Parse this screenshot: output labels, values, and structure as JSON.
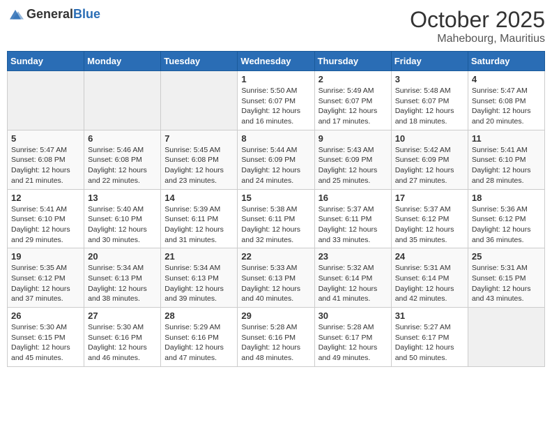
{
  "header": {
    "logo": {
      "general": "General",
      "blue": "Blue"
    },
    "month": "October 2025",
    "location": "Mahebourg, Mauritius"
  },
  "weekdays": [
    "Sunday",
    "Monday",
    "Tuesday",
    "Wednesday",
    "Thursday",
    "Friday",
    "Saturday"
  ],
  "weeks": [
    [
      {
        "day": "",
        "info": ""
      },
      {
        "day": "",
        "info": ""
      },
      {
        "day": "",
        "info": ""
      },
      {
        "day": "1",
        "info": "Sunrise: 5:50 AM\nSunset: 6:07 PM\nDaylight: 12 hours\nand 16 minutes."
      },
      {
        "day": "2",
        "info": "Sunrise: 5:49 AM\nSunset: 6:07 PM\nDaylight: 12 hours\nand 17 minutes."
      },
      {
        "day": "3",
        "info": "Sunrise: 5:48 AM\nSunset: 6:07 PM\nDaylight: 12 hours\nand 18 minutes."
      },
      {
        "day": "4",
        "info": "Sunrise: 5:47 AM\nSunset: 6:08 PM\nDaylight: 12 hours\nand 20 minutes."
      }
    ],
    [
      {
        "day": "5",
        "info": "Sunrise: 5:47 AM\nSunset: 6:08 PM\nDaylight: 12 hours\nand 21 minutes."
      },
      {
        "day": "6",
        "info": "Sunrise: 5:46 AM\nSunset: 6:08 PM\nDaylight: 12 hours\nand 22 minutes."
      },
      {
        "day": "7",
        "info": "Sunrise: 5:45 AM\nSunset: 6:08 PM\nDaylight: 12 hours\nand 23 minutes."
      },
      {
        "day": "8",
        "info": "Sunrise: 5:44 AM\nSunset: 6:09 PM\nDaylight: 12 hours\nand 24 minutes."
      },
      {
        "day": "9",
        "info": "Sunrise: 5:43 AM\nSunset: 6:09 PM\nDaylight: 12 hours\nand 25 minutes."
      },
      {
        "day": "10",
        "info": "Sunrise: 5:42 AM\nSunset: 6:09 PM\nDaylight: 12 hours\nand 27 minutes."
      },
      {
        "day": "11",
        "info": "Sunrise: 5:41 AM\nSunset: 6:10 PM\nDaylight: 12 hours\nand 28 minutes."
      }
    ],
    [
      {
        "day": "12",
        "info": "Sunrise: 5:41 AM\nSunset: 6:10 PM\nDaylight: 12 hours\nand 29 minutes."
      },
      {
        "day": "13",
        "info": "Sunrise: 5:40 AM\nSunset: 6:10 PM\nDaylight: 12 hours\nand 30 minutes."
      },
      {
        "day": "14",
        "info": "Sunrise: 5:39 AM\nSunset: 6:11 PM\nDaylight: 12 hours\nand 31 minutes."
      },
      {
        "day": "15",
        "info": "Sunrise: 5:38 AM\nSunset: 6:11 PM\nDaylight: 12 hours\nand 32 minutes."
      },
      {
        "day": "16",
        "info": "Sunrise: 5:37 AM\nSunset: 6:11 PM\nDaylight: 12 hours\nand 33 minutes."
      },
      {
        "day": "17",
        "info": "Sunrise: 5:37 AM\nSunset: 6:12 PM\nDaylight: 12 hours\nand 35 minutes."
      },
      {
        "day": "18",
        "info": "Sunrise: 5:36 AM\nSunset: 6:12 PM\nDaylight: 12 hours\nand 36 minutes."
      }
    ],
    [
      {
        "day": "19",
        "info": "Sunrise: 5:35 AM\nSunset: 6:12 PM\nDaylight: 12 hours\nand 37 minutes."
      },
      {
        "day": "20",
        "info": "Sunrise: 5:34 AM\nSunset: 6:13 PM\nDaylight: 12 hours\nand 38 minutes."
      },
      {
        "day": "21",
        "info": "Sunrise: 5:34 AM\nSunset: 6:13 PM\nDaylight: 12 hours\nand 39 minutes."
      },
      {
        "day": "22",
        "info": "Sunrise: 5:33 AM\nSunset: 6:13 PM\nDaylight: 12 hours\nand 40 minutes."
      },
      {
        "day": "23",
        "info": "Sunrise: 5:32 AM\nSunset: 6:14 PM\nDaylight: 12 hours\nand 41 minutes."
      },
      {
        "day": "24",
        "info": "Sunrise: 5:31 AM\nSunset: 6:14 PM\nDaylight: 12 hours\nand 42 minutes."
      },
      {
        "day": "25",
        "info": "Sunrise: 5:31 AM\nSunset: 6:15 PM\nDaylight: 12 hours\nand 43 minutes."
      }
    ],
    [
      {
        "day": "26",
        "info": "Sunrise: 5:30 AM\nSunset: 6:15 PM\nDaylight: 12 hours\nand 45 minutes."
      },
      {
        "day": "27",
        "info": "Sunrise: 5:30 AM\nSunset: 6:16 PM\nDaylight: 12 hours\nand 46 minutes."
      },
      {
        "day": "28",
        "info": "Sunrise: 5:29 AM\nSunset: 6:16 PM\nDaylight: 12 hours\nand 47 minutes."
      },
      {
        "day": "29",
        "info": "Sunrise: 5:28 AM\nSunset: 6:16 PM\nDaylight: 12 hours\nand 48 minutes."
      },
      {
        "day": "30",
        "info": "Sunrise: 5:28 AM\nSunset: 6:17 PM\nDaylight: 12 hours\nand 49 minutes."
      },
      {
        "day": "31",
        "info": "Sunrise: 5:27 AM\nSunset: 6:17 PM\nDaylight: 12 hours\nand 50 minutes."
      },
      {
        "day": "",
        "info": ""
      }
    ]
  ]
}
